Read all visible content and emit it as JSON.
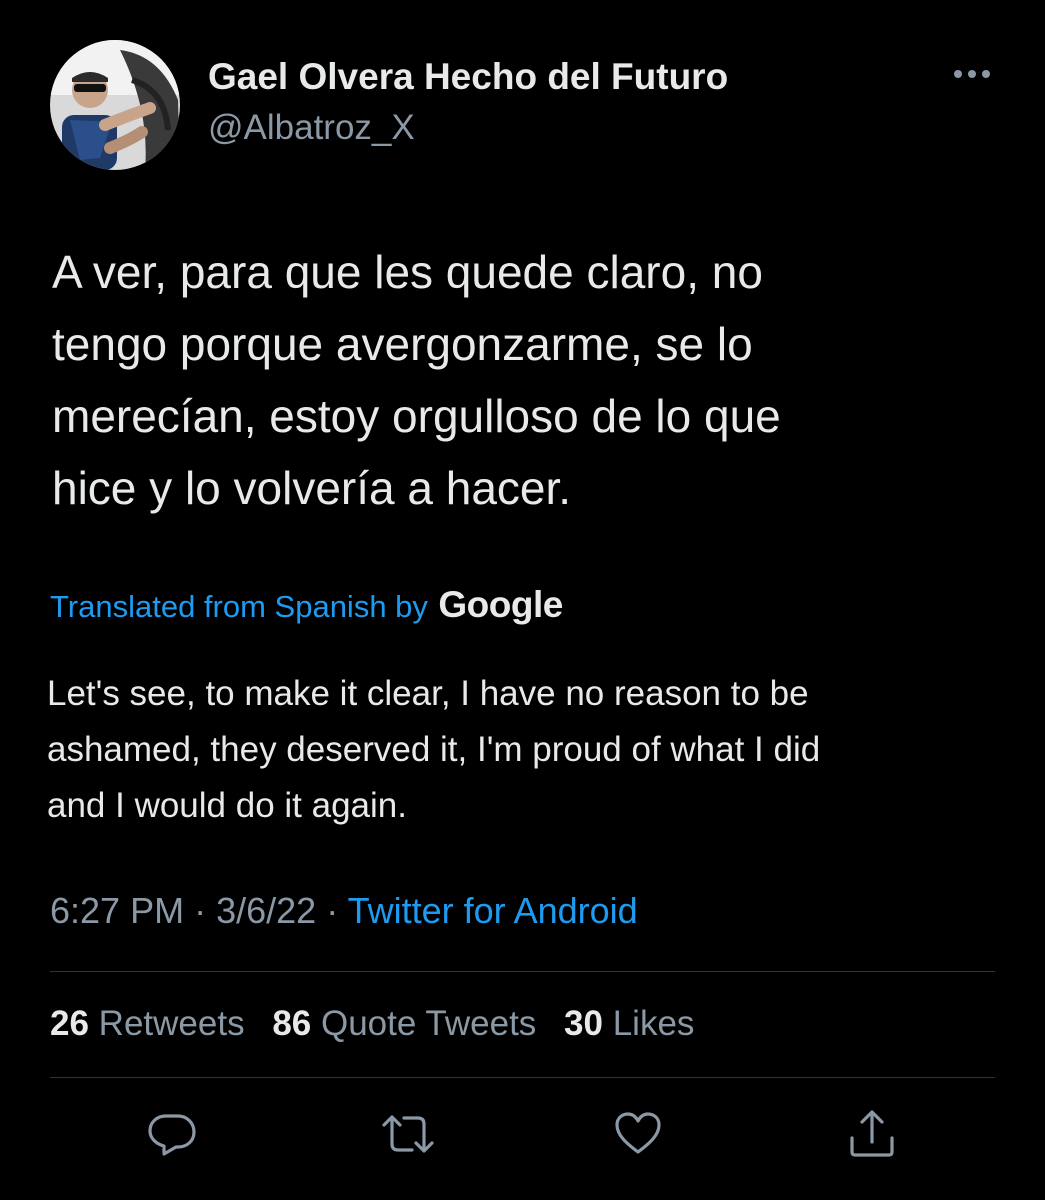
{
  "author": {
    "display_name": "Gael Olvera Hecho del Futuro",
    "handle": "@Albatroz_X"
  },
  "tweet": {
    "text": "A ver, para que les quede claro, no\ntengo porque avergonzarme, se lo\nmerecían, estoy orgulloso de lo que\nhice y lo volvería a hacer.",
    "translated_label": "Translated from Spanish by",
    "translated_provider": "Google",
    "translation": "Let's see, to make it clear, I have no reason to be\nashamed, they deserved it, I'm proud of what I did\nand I would do it again."
  },
  "meta": {
    "time": "6:27 PM",
    "date": "3/6/22",
    "separator": "·",
    "source": "Twitter for Android"
  },
  "stats": {
    "retweets_count": "26",
    "retweets_label": "Retweets",
    "quotes_count": "86",
    "quotes_label": "Quote Tweets",
    "likes_count": "30",
    "likes_label": "Likes"
  },
  "icons": {
    "reply": "reply-icon",
    "retweet": "retweet-icon",
    "like": "heart-icon",
    "share": "share-icon",
    "more": "more-icon"
  },
  "colors": {
    "background": "#000000",
    "text": "#e7e9ea",
    "secondary": "#8b98a5",
    "accent": "#1d9bf0",
    "divider": "#2f3336"
  }
}
